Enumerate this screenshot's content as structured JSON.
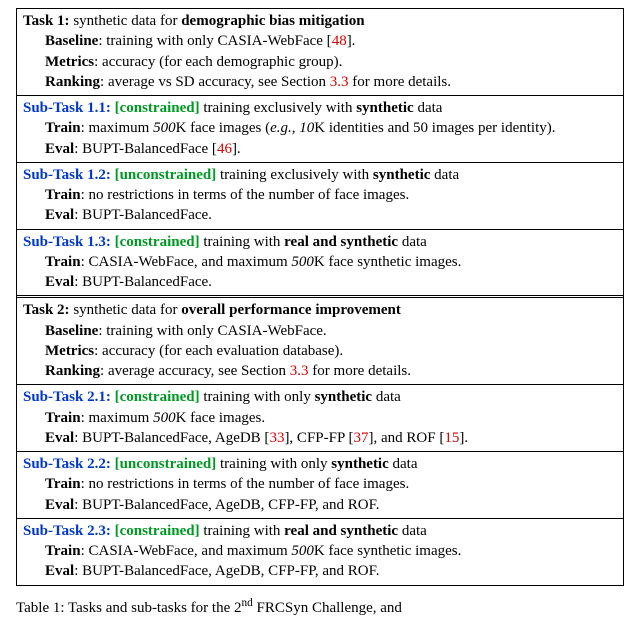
{
  "task1": {
    "header_label": "Task 1:",
    "header_desc_a": " synthetic data for ",
    "header_desc_b": "demographic bias mitigation",
    "baseline_label": "Baseline",
    "baseline_text": ": training with only CASIA-WebFace [",
    "baseline_ref": "48",
    "baseline_tail": "].",
    "metrics_label": "Metrics",
    "metrics_text": ": accuracy (for each demographic group).",
    "ranking_label": "Ranking",
    "ranking_text_a": ": average vs SD accuracy, see Section ",
    "ranking_ref": "3.3",
    "ranking_text_b": " for more details.",
    "sub1": {
      "label": "Sub-Task 1.1:",
      "constraint": " [constrained]",
      "desc_a": " training exclusively with ",
      "desc_b": "synthetic",
      "desc_c": " data",
      "train_label": "Train",
      "train_a": ": maximum ",
      "train_k": "500K",
      "train_b": " face images (",
      "train_eg": "e.g.,",
      "train_c": " 10K",
      "train_d": " identities and 50 images per identity).",
      "eval_label": "Eval",
      "eval_a": ": BUPT-BalancedFace [",
      "eval_ref": "46",
      "eval_b": "]."
    },
    "sub2": {
      "label": "Sub-Task 1.2:",
      "constraint": " [unconstrained]",
      "desc_a": " training exclusively with ",
      "desc_b": "synthetic",
      "desc_c": " data",
      "train_label": "Train",
      "train_text": ": no restrictions in terms of the number of face images.",
      "eval_label": "Eval",
      "eval_text": ": BUPT-BalancedFace."
    },
    "sub3": {
      "label": "Sub-Task 1.3:",
      "constraint": " [constrained]",
      "desc_a": " training with ",
      "desc_b": "real and synthetic",
      "desc_c": " data",
      "train_label": "Train",
      "train_a": ": CASIA-WebFace, and maximum ",
      "train_k": "500K",
      "train_b": " face synthetic images.",
      "eval_label": "Eval",
      "eval_text": ": BUPT-BalancedFace."
    }
  },
  "task2": {
    "header_label": "Task 2:",
    "header_desc_a": " synthetic data for ",
    "header_desc_b": "overall performance improvement",
    "baseline_label": "Baseline",
    "baseline_text": ": training with only CASIA-WebFace.",
    "metrics_label": "Metrics",
    "metrics_text": ": accuracy (for each evaluation database).",
    "ranking_label": "Ranking",
    "ranking_text_a": ": average accuracy, see Section ",
    "ranking_ref": "3.3",
    "ranking_text_b": " for more details.",
    "sub1": {
      "label": "Sub-Task 2.1:",
      "constraint": " [constrained]",
      "desc_a": " training with only ",
      "desc_b": "synthetic",
      "desc_c": " data",
      "train_label": "Train",
      "train_a": ": maximum ",
      "train_k": "500K",
      "train_b": " face images.",
      "eval_label": "Eval",
      "eval_a": ": BUPT-BalancedFace, AgeDB [",
      "eval_ref1": "33",
      "eval_b": "], CFP-FP [",
      "eval_ref2": "37",
      "eval_c": "], and ROF [",
      "eval_ref3": "15",
      "eval_d": "]."
    },
    "sub2": {
      "label": "Sub-Task 2.2:",
      "constraint": " [unconstrained]",
      "desc_a": " training with only ",
      "desc_b": "synthetic",
      "desc_c": " data",
      "train_label": "Train",
      "train_text": ": no restrictions in terms of the number of face images.",
      "eval_label": "Eval",
      "eval_text": ": BUPT-BalancedFace, AgeDB, CFP-FP, and ROF."
    },
    "sub3": {
      "label": "Sub-Task 2.3:",
      "constraint": " [constrained]",
      "desc_a": " training with ",
      "desc_b": "real and synthetic",
      "desc_c": " data",
      "train_label": "Train",
      "train_a": ": CASIA-WebFace, and maximum ",
      "train_k": "500K",
      "train_b": " face synthetic images.",
      "eval_label": "Eval",
      "eval_text": ": BUPT-BalancedFace, AgeDB, CFP-FP, and ROF."
    }
  },
  "caption": {
    "prefix": "Table 1: Tasks and sub-tasks for the 2",
    "sup": "nd",
    "suffix": " FRCSyn Challenge, and"
  }
}
